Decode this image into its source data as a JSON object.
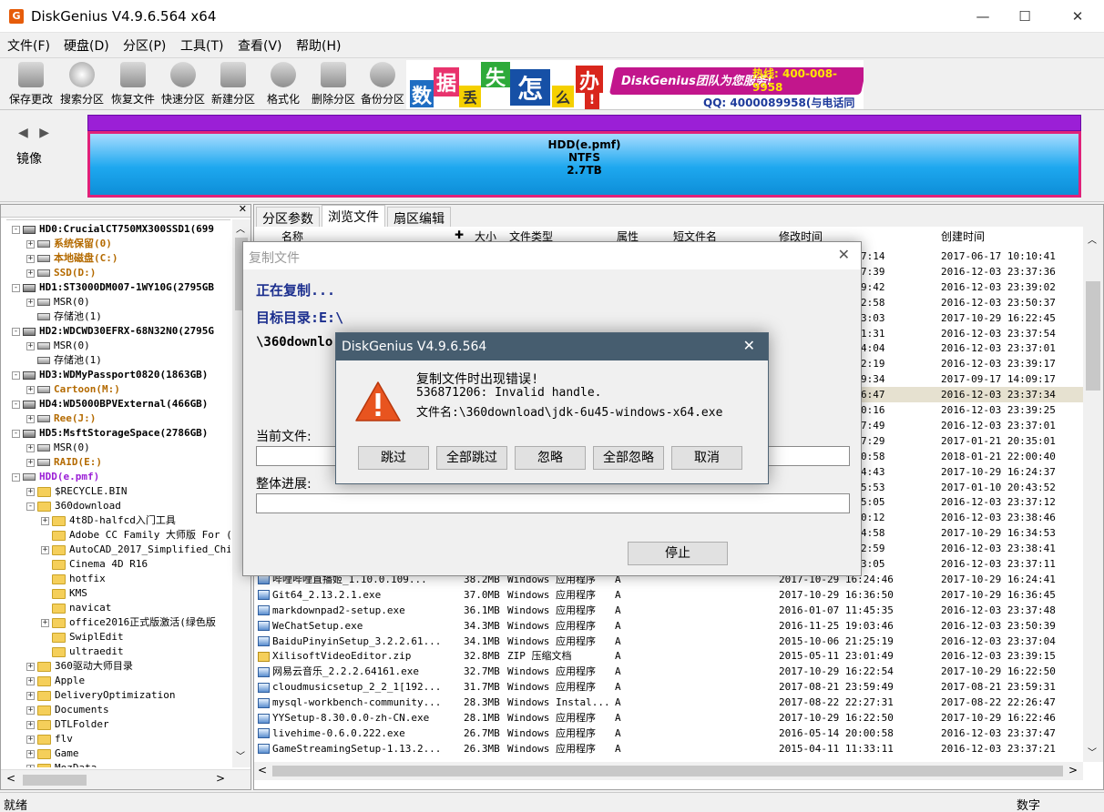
{
  "window": {
    "title": "DiskGenius V4.9.6.564 x64",
    "icon_letter": "G",
    "minimize": "—",
    "maximize": "☐",
    "close": "✕"
  },
  "menu": [
    "文件(F)",
    "硬盘(D)",
    "分区(P)",
    "工具(T)",
    "查看(V)",
    "帮助(H)"
  ],
  "toolbar": [
    "保存更改",
    "搜索分区",
    "恢复文件",
    "快速分区",
    "新建分区",
    "格式化",
    "删除分区",
    "备份分区"
  ],
  "banner": {
    "tiles": [
      "数",
      "据",
      "丢",
      "失",
      "怎",
      "么",
      "办",
      "!"
    ],
    "slogan": "DiskGenius团队为您服务!",
    "tel": "热线: 400-008-9958",
    "qq": "QQ: 4000089958(与电话同号)"
  },
  "diskmap": {
    "nav": "◀ ▶",
    "mirror": "镜像",
    "name": "HDD(e.pmf)",
    "fs": "NTFS",
    "size": "2.7TB"
  },
  "tree": [
    {
      "exp": "-",
      "icon": "hdd",
      "text": "HD0:CrucialCT750MX300SSD1(699",
      "style": "bold",
      "indent": 0
    },
    {
      "exp": "+",
      "icon": "part",
      "text": "系统保留(0)",
      "style": "brown",
      "indent": 1
    },
    {
      "exp": "+",
      "icon": "part",
      "text": "本地磁盘(C:)",
      "style": "brown",
      "indent": 1
    },
    {
      "exp": "+",
      "icon": "part",
      "text": "SSD(D:)",
      "style": "brown",
      "indent": 1
    },
    {
      "exp": "-",
      "icon": "hdd",
      "text": "HD1:ST3000DM007-1WY10G(2795GB",
      "style": "bold",
      "indent": 0
    },
    {
      "exp": "+",
      "icon": "part",
      "text": "MSR(0)",
      "style": "",
      "indent": 1
    },
    {
      "exp": "",
      "icon": "part",
      "text": "存储池(1)",
      "style": "",
      "indent": 1
    },
    {
      "exp": "-",
      "icon": "hdd",
      "text": "HD2:WDCWD30EFRX-68N32N0(2795G",
      "style": "bold",
      "indent": 0
    },
    {
      "exp": "+",
      "icon": "part",
      "text": "MSR(0)",
      "style": "",
      "indent": 1
    },
    {
      "exp": "",
      "icon": "part",
      "text": "存储池(1)",
      "style": "",
      "indent": 1
    },
    {
      "exp": "-",
      "icon": "hdd",
      "text": "HD3:WDMyPassport0820(1863GB)",
      "style": "bold",
      "indent": 0
    },
    {
      "exp": "+",
      "icon": "part",
      "text": "Cartoon(M:)",
      "style": "brown",
      "indent": 1
    },
    {
      "exp": "-",
      "icon": "hdd",
      "text": "HD4:WD5000BPVExternal(466GB)",
      "style": "bold",
      "indent": 0
    },
    {
      "exp": "+",
      "icon": "part",
      "text": "Ree(J:)",
      "style": "brown",
      "indent": 1
    },
    {
      "exp": "-",
      "icon": "hdd",
      "text": "HD5:MsftStorageSpace(2786GB)",
      "style": "bold",
      "indent": 0
    },
    {
      "exp": "+",
      "icon": "part",
      "text": "MSR(0)",
      "style": "",
      "indent": 1
    },
    {
      "exp": "+",
      "icon": "part",
      "text": "RAID(E:)",
      "style": "brown",
      "indent": 1
    },
    {
      "exp": "-",
      "icon": "part",
      "text": "HDD(e.pmf)",
      "style": "purple",
      "indent": 0
    },
    {
      "exp": "+",
      "icon": "folder",
      "text": "$RECYCLE.BIN",
      "style": "",
      "indent": 1
    },
    {
      "exp": "-",
      "icon": "folder",
      "text": "360download",
      "style": "",
      "indent": 1
    },
    {
      "exp": "+",
      "icon": "folder",
      "text": "4t8D-halfcd入门工具",
      "style": "",
      "indent": 2
    },
    {
      "exp": "",
      "icon": "folder",
      "text": "Adobe CC Family 大师版 For (",
      "style": "",
      "indent": 2
    },
    {
      "exp": "+",
      "icon": "folder",
      "text": "AutoCAD_2017_Simplified_Chir",
      "style": "",
      "indent": 2
    },
    {
      "exp": "",
      "icon": "folder",
      "text": "Cinema 4D R16",
      "style": "",
      "indent": 2
    },
    {
      "exp": "",
      "icon": "folder",
      "text": "hotfix",
      "style": "",
      "indent": 2
    },
    {
      "exp": "",
      "icon": "folder",
      "text": "KMS",
      "style": "",
      "indent": 2
    },
    {
      "exp": "",
      "icon": "folder",
      "text": "navicat",
      "style": "",
      "indent": 2
    },
    {
      "exp": "+",
      "icon": "folder",
      "text": "office2016正式版激活(绿色版",
      "style": "",
      "indent": 2
    },
    {
      "exp": "",
      "icon": "folder",
      "text": "SwiplEdit",
      "style": "",
      "indent": 2
    },
    {
      "exp": "",
      "icon": "folder",
      "text": "ultraedit",
      "style": "",
      "indent": 2
    },
    {
      "exp": "+",
      "icon": "folder",
      "text": "360驱动大师目录",
      "style": "",
      "indent": 1
    },
    {
      "exp": "+",
      "icon": "folder",
      "text": "Apple",
      "style": "",
      "indent": 1
    },
    {
      "exp": "+",
      "icon": "folder",
      "text": "DeliveryOptimization",
      "style": "",
      "indent": 1
    },
    {
      "exp": "+",
      "icon": "folder",
      "text": "Documents",
      "style": "",
      "indent": 1
    },
    {
      "exp": "+",
      "icon": "folder",
      "text": "DTLFolder",
      "style": "",
      "indent": 1
    },
    {
      "exp": "+",
      "icon": "folder",
      "text": "flv",
      "style": "",
      "indent": 1
    },
    {
      "exp": "+",
      "icon": "folder",
      "text": "Game",
      "style": "",
      "indent": 1
    },
    {
      "exp": "+",
      "icon": "folder",
      "text": "MozData",
      "style": "",
      "indent": 1
    }
  ],
  "tabs": [
    "分区参数",
    "浏览文件",
    "扇区编辑"
  ],
  "columns": [
    "名称",
    "大小",
    "文件类型",
    "属性",
    "短文件名",
    "修改时间",
    "创建时间"
  ],
  "partial_rows": [
    {
      "mod": "7:14",
      "created": "2017-06-17 10:10:41"
    },
    {
      "mod": "7:39",
      "created": "2016-12-03 23:37:36"
    },
    {
      "mod": "9:42",
      "created": "2016-12-03 23:39:02"
    },
    {
      "mod": "2:58",
      "created": "2016-12-03 23:50:37"
    },
    {
      "mod": "3:03",
      "created": "2017-10-29 16:22:45"
    },
    {
      "mod": "1:31",
      "created": "2016-12-03 23:37:54"
    },
    {
      "mod": "4:04",
      "created": "2016-12-03 23:37:01"
    },
    {
      "mod": "2:19",
      "created": "2016-12-03 23:39:17"
    },
    {
      "mod": "9:34",
      "created": "2017-09-17 14:09:17"
    },
    {
      "mod": "6:47",
      "created": "2016-12-03 23:37:34"
    },
    {
      "mod": "0:16",
      "created": "2016-12-03 23:39:25"
    },
    {
      "mod": "7:49",
      "created": "2016-12-03 23:37:01"
    },
    {
      "mod": "7:29",
      "created": "2017-01-21 20:35:01"
    },
    {
      "mod": "0:58",
      "created": "2018-01-21 22:00:40"
    },
    {
      "mod": "4:43",
      "created": "2017-10-29 16:24:37"
    },
    {
      "mod": "5:53",
      "created": "2017-01-10 20:43:52"
    },
    {
      "mod": "5:05",
      "created": "2016-12-03 23:37:12"
    },
    {
      "mod": "0:12",
      "created": "2016-12-03 23:38:46"
    },
    {
      "mod": "4:58",
      "created": "2017-10-29 16:34:53"
    },
    {
      "mod": "2:59",
      "created": "2016-12-03 23:38:41"
    },
    {
      "mod": "3:05",
      "created": "2016-12-03 23:37:11"
    }
  ],
  "files": [
    {
      "name": "哔哩哔哩直播姬_1.10.0.109...",
      "size": "38.2MB",
      "type": "Windows 应用程序",
      "attr": "A",
      "mod": "2017-10-29 16:24:46",
      "created": "2017-10-29 16:24:41",
      "icon": "exe"
    },
    {
      "name": "Git64_2.13.2.1.exe",
      "size": "37.0MB",
      "type": "Windows 应用程序",
      "attr": "A",
      "mod": "2017-10-29 16:36:50",
      "created": "2017-10-29 16:36:45",
      "icon": "exe"
    },
    {
      "name": "markdownpad2-setup.exe",
      "size": "36.1MB",
      "type": "Windows 应用程序",
      "attr": "A",
      "mod": "2016-01-07 11:45:35",
      "created": "2016-12-03 23:37:48",
      "icon": "exe"
    },
    {
      "name": "WeChatSetup.exe",
      "size": "34.3MB",
      "type": "Windows 应用程序",
      "attr": "A",
      "mod": "2016-11-25 19:03:46",
      "created": "2016-12-03 23:50:39",
      "icon": "exe"
    },
    {
      "name": "BaiduPinyinSetup_3.2.2.61...",
      "size": "34.1MB",
      "type": "Windows 应用程序",
      "attr": "A",
      "mod": "2015-10-06 21:25:19",
      "created": "2016-12-03 23:37:04",
      "icon": "exe"
    },
    {
      "name": "XilisoftVideoEditor.zip",
      "size": "32.8MB",
      "type": "ZIP 压缩文档",
      "attr": "A",
      "mod": "2015-05-11 23:01:49",
      "created": "2016-12-03 23:39:15",
      "icon": "zip"
    },
    {
      "name": "网易云音乐_2.2.2.64161.exe",
      "size": "32.7MB",
      "type": "Windows 应用程序",
      "attr": "A",
      "mod": "2017-10-29 16:22:54",
      "created": "2017-10-29 16:22:50",
      "icon": "exe"
    },
    {
      "name": "cloudmusicsetup_2_2_1[192...",
      "size": "31.7MB",
      "type": "Windows 应用程序",
      "attr": "A",
      "mod": "2017-08-21 23:59:49",
      "created": "2017-08-21 23:59:31",
      "icon": "exe"
    },
    {
      "name": "mysql-workbench-community...",
      "size": "28.3MB",
      "type": "Windows Instal...",
      "attr": "A",
      "mod": "2017-08-22 22:27:31",
      "created": "2017-08-22 22:26:47",
      "icon": "msi"
    },
    {
      "name": "YYSetup-8.30.0.0-zh-CN.exe",
      "size": "28.1MB",
      "type": "Windows 应用程序",
      "attr": "A",
      "mod": "2017-10-29 16:22:50",
      "created": "2017-10-29 16:22:46",
      "icon": "exe"
    },
    {
      "name": "livehime-0.6.0.222.exe",
      "size": "26.7MB",
      "type": "Windows 应用程序",
      "attr": "A",
      "mod": "2016-05-14 20:00:58",
      "created": "2016-12-03 23:37:47",
      "icon": "exe"
    },
    {
      "name": "GameStreamingSetup-1.13.2...",
      "size": "26.3MB",
      "type": "Windows 应用程序",
      "attr": "A",
      "mod": "2015-04-11 11:33:11",
      "created": "2016-12-03 23:37:21",
      "icon": "exe"
    }
  ],
  "copy_dialog": {
    "title": "复制文件",
    "status": "正在复制...",
    "target": "目标目录:E:\\",
    "path_prefix": "\\360downlo",
    "current_label": "当前文件:",
    "overall_label": "整体进展:",
    "stop": "停止"
  },
  "error_dialog": {
    "title": "DiskGenius V4.9.6.564",
    "line1": "复制文件时出现错误!",
    "line2": "536871206: Invalid handle.",
    "line3": "文件名:\\360download\\jdk-6u45-windows-x64.exe",
    "buttons": [
      "跳过",
      "全部跳过",
      "忽略",
      "全部忽略",
      "取消"
    ]
  },
  "status": {
    "left": "就绪",
    "right": "数字"
  },
  "colors": {
    "partition_border": "#e0217a",
    "disk_bar": "#9b1fd6",
    "error_title_bg": "#465d6f",
    "selected_row": "#e6e1d0"
  }
}
